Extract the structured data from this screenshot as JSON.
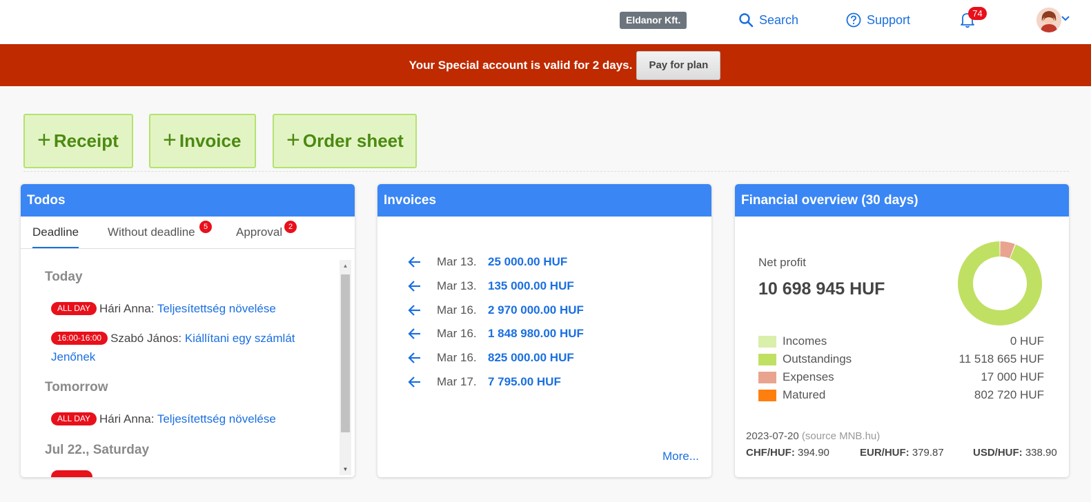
{
  "header": {
    "company": "Eldanor Kft.",
    "search_label": "Search",
    "support_label": "Support",
    "notifications_count": "74"
  },
  "banner": {
    "text": "Your Special account is valid for 2 days.",
    "button_label": "Pay for plan"
  },
  "quick_actions": {
    "receipt": "Receipt",
    "invoice": "Invoice",
    "order_sheet": "Order sheet"
  },
  "todos": {
    "title": "Todos",
    "tabs": [
      {
        "label": "Deadline",
        "badge": ""
      },
      {
        "label": "Without deadline",
        "badge": "5"
      },
      {
        "label": "Approval",
        "badge": "2"
      }
    ],
    "groups": [
      {
        "day": "Today",
        "items": [
          {
            "time": "ALL DAY",
            "person": "Hári Anna:",
            "task": "Teljesítettség növelése"
          },
          {
            "time": "16:00-16:00",
            "person": "Szabó János:",
            "task": "Kiállítani egy számlát Jenőnek"
          }
        ]
      },
      {
        "day": "Tomorrow",
        "items": [
          {
            "time": "ALL DAY",
            "person": "Hári Anna:",
            "task": "Teljesítettség növelése"
          }
        ]
      },
      {
        "day": "Jul 22., Saturday",
        "items": []
      }
    ]
  },
  "invoices": {
    "title": "Invoices",
    "rows": [
      {
        "date": "Mar 13.",
        "amount": "25 000.00 HUF"
      },
      {
        "date": "Mar 13.",
        "amount": "135 000.00 HUF"
      },
      {
        "date": "Mar 16.",
        "amount": "2 970 000.00 HUF"
      },
      {
        "date": "Mar 16.",
        "amount": "1 848 980.00 HUF"
      },
      {
        "date": "Mar 16.",
        "amount": "825 000.00 HUF"
      },
      {
        "date": "Mar 17.",
        "amount": "7 795.00 HUF"
      }
    ],
    "more_label": "More..."
  },
  "financial": {
    "title": "Financial overview (30 days)",
    "net_profit_label": "Net profit",
    "net_profit_value": "10 698 945 HUF",
    "legend": [
      {
        "name": "Incomes",
        "value": "0 HUF",
        "color": "#d9efaa"
      },
      {
        "name": "Outstandings",
        "value": "11 518 665 HUF",
        "color": "#c0e063"
      },
      {
        "name": "Expenses",
        "value": "17 000 HUF",
        "color": "#e8a48f"
      },
      {
        "name": "Matured",
        "value": "802 720 HUF",
        "color": "#ff7f0e"
      }
    ],
    "donut_share": {
      "outstandings": 0.94,
      "expenses": 0.06
    },
    "rates_date": "2023-07-20",
    "rates_source": "(source MNB.hu)",
    "rates": [
      {
        "pair": "CHF/HUF:",
        "value": "394.90"
      },
      {
        "pair": "EUR/HUF:",
        "value": "379.87"
      },
      {
        "pair": "USD/HUF:",
        "value": "338.90"
      }
    ]
  },
  "colors": {
    "accent": "#3a86f4",
    "banner": "#bf2a00",
    "link": "#1a6fe0",
    "badge": "#e8101a",
    "quick_button_bg": "#e3f4c4"
  }
}
